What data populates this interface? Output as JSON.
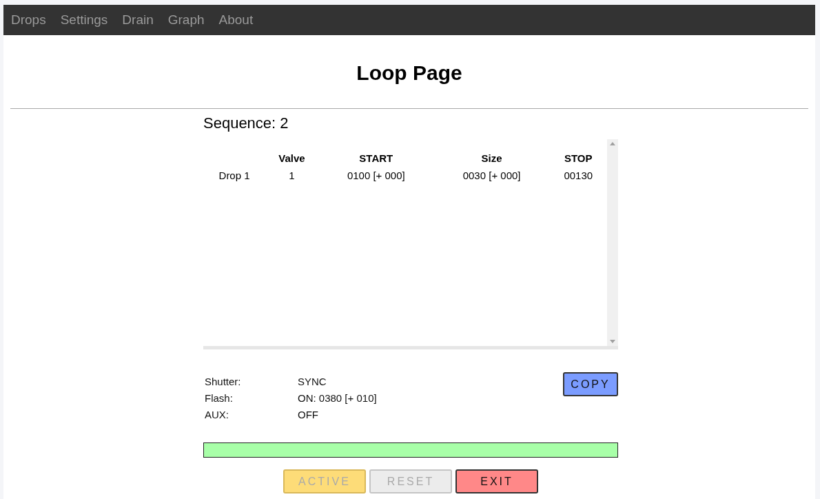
{
  "nav": [
    {
      "label": "Drops"
    },
    {
      "label": "Settings"
    },
    {
      "label": "Drain"
    },
    {
      "label": "Graph"
    },
    {
      "label": "About"
    }
  ],
  "title": "Loop Page",
  "sequence": "Sequence: 2",
  "table": {
    "columns": [
      "Valve",
      "START",
      "Size",
      "STOP"
    ],
    "rows": [
      {
        "name": "Drop 1",
        "cells": [
          "1",
          "0100 [+ 000]",
          "0030 [+ 000]",
          "00130"
        ]
      }
    ]
  },
  "settings": [
    {
      "label": "Shutter:",
      "value": "SYNC"
    },
    {
      "label": "Flash:",
      "value": "ON: 0380 [+ 010]"
    },
    {
      "label": "AUX:",
      "value": "OFF"
    }
  ],
  "copy_button": "COPY",
  "progress": {
    "level": 1
  },
  "buttons": [
    {
      "label": "ACTIVE",
      "kind": "active",
      "disabled": true
    },
    {
      "label": "RESET",
      "kind": "reset",
      "disabled": true
    },
    {
      "label": "EXIT",
      "kind": "exit",
      "disabled": false
    }
  ]
}
